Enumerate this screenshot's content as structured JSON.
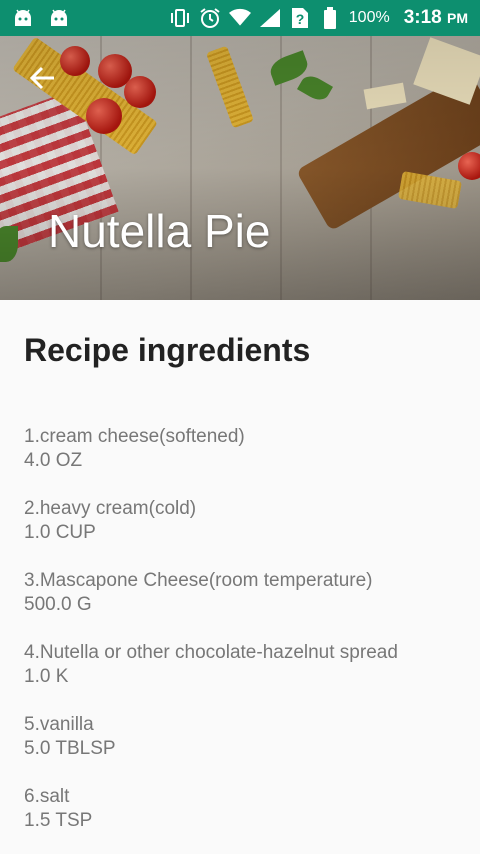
{
  "status_bar": {
    "battery": "100%",
    "time": "3:18",
    "ampm": "PM",
    "icons": [
      "android-icon",
      "android-icon",
      "vibrate-icon",
      "alarm-icon",
      "wifi-icon",
      "signal-icon",
      "no-sim-icon",
      "battery-icon"
    ]
  },
  "header": {
    "title": "Nutella Pie"
  },
  "main": {
    "section_title": "Recipe ingredients",
    "ingredients": [
      {
        "name": "1.cream cheese(softened)",
        "amount": "4.0 OZ"
      },
      {
        "name": "2.heavy cream(cold)",
        "amount": "1.0 CUP"
      },
      {
        "name": "3.Mascapone Cheese(room temperature)",
        "amount": "500.0 G"
      },
      {
        "name": "4.Nutella or other chocolate-hazelnut spread",
        "amount": "1.0 K"
      },
      {
        "name": "5.vanilla",
        "amount": "5.0 TBLSP"
      },
      {
        "name": "6.salt",
        "amount": "1.5 TSP"
      }
    ]
  },
  "colors": {
    "status_bar": "#0d8f6f",
    "title_text": "#ffffff",
    "ingredient_text": "#777777"
  }
}
